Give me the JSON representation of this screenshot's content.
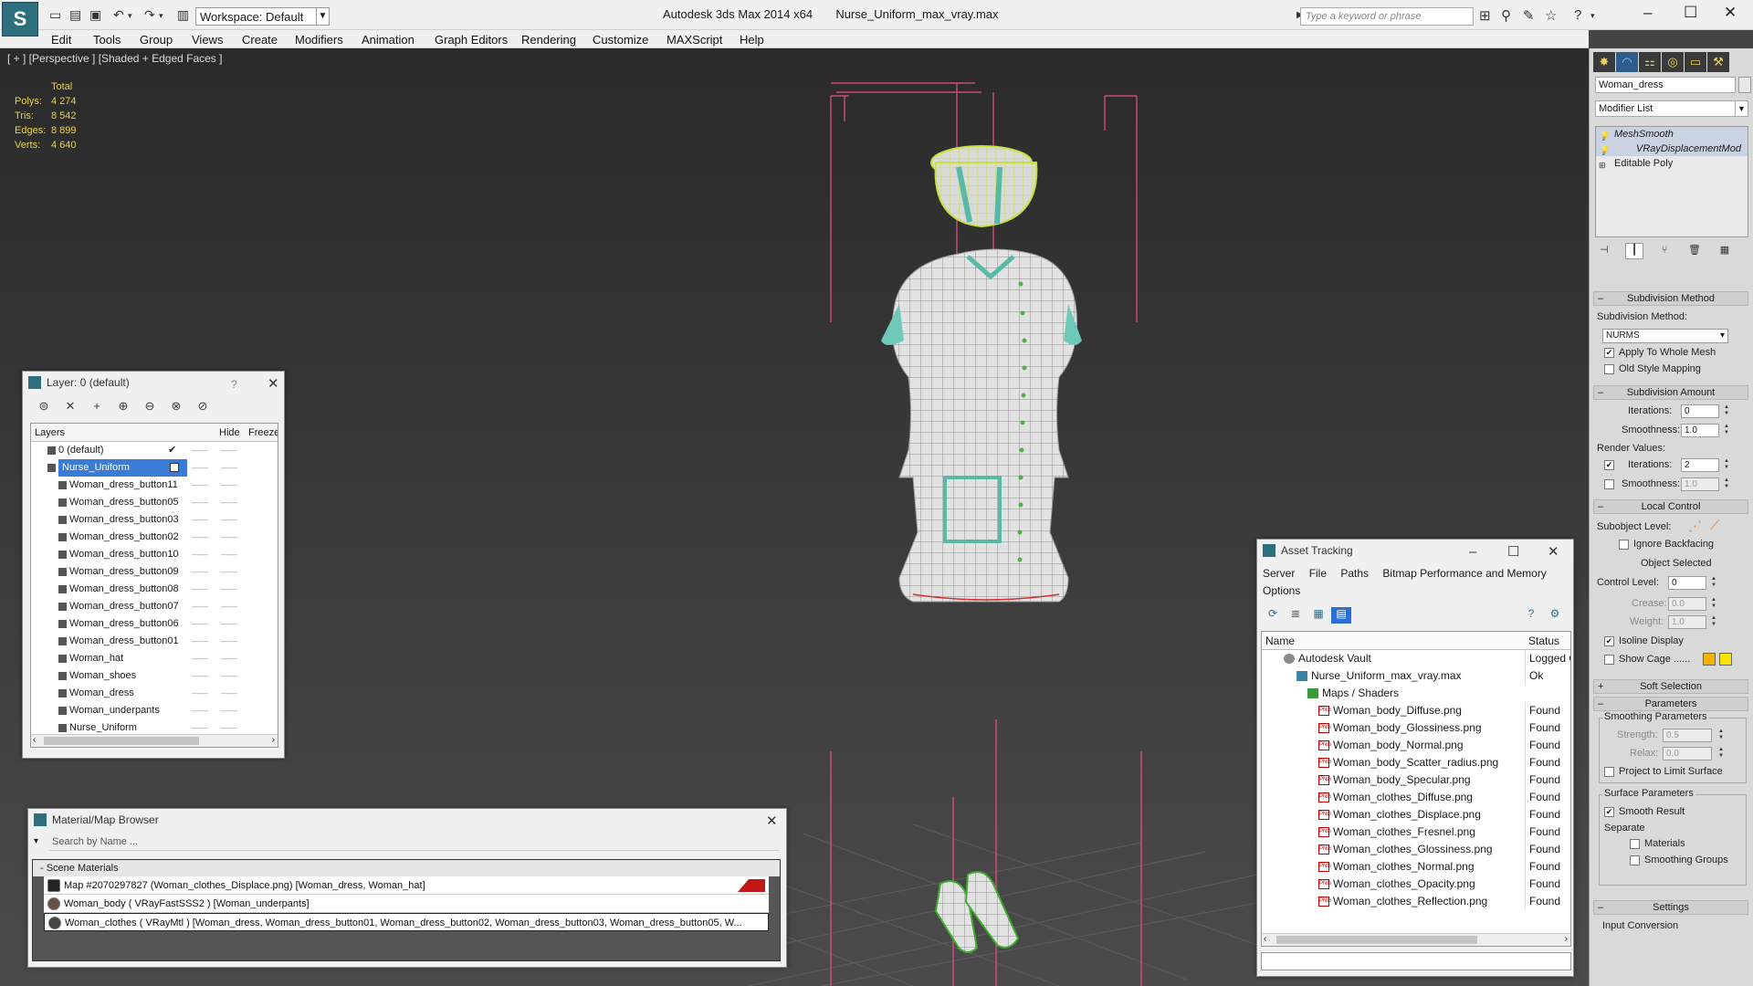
{
  "titlebar": {
    "app_logo": "S",
    "workspace": "Workspace: Default",
    "app_name": "Autodesk 3ds Max  2014 x64",
    "file_name": "Nurse_Uniform_max_vray.max",
    "search_placeholder": "Type a keyword or phrase"
  },
  "menu": [
    "Edit",
    "Tools",
    "Group",
    "Views",
    "Create",
    "Modifiers",
    "Animation",
    "Graph Editors",
    "Rendering",
    "Customize",
    "MAXScript",
    "Help"
  ],
  "viewport": {
    "label": "[ + ] [Perspective ] [Shaded + Edged Faces ]",
    "stats_header": "Total",
    "stats": [
      {
        "label": "Polys:",
        "value": "4 274"
      },
      {
        "label": "Tris:",
        "value": "8 542"
      },
      {
        "label": "Edges:",
        "value": "8 899"
      },
      {
        "label": "Verts:",
        "value": "4 640"
      }
    ]
  },
  "command_panel": {
    "object_name": "Woman_dress",
    "modifier_list": "Modifier List",
    "stack": [
      "MeshSmooth",
      "VRayDisplacementMod",
      "Editable Poly"
    ],
    "rollouts": {
      "subdivision_method": "Subdivision Method",
      "subdivision_method_label": "Subdivision Method:",
      "subdivision_method_value": "NURMS",
      "apply_whole_mesh": "Apply To Whole Mesh",
      "old_style_mapping": "Old Style Mapping",
      "subdivision_amount": "Subdivision Amount",
      "iterations_label": "Iterations:",
      "iterations_value": "0",
      "smoothness_label": "Smoothness:",
      "smoothness_value": "1.0",
      "render_values": "Render Values:",
      "render_iterations_value": "2",
      "render_smoothness_value": "1.0",
      "local_control": "Local Control",
      "subobject_level": "Subobject Level:",
      "ignore_backfacing": "Ignore Backfacing",
      "object_selected": "Object Selected",
      "control_level": "Control Level:",
      "control_level_value": "0",
      "crease": "Crease:",
      "crease_value": "0.0",
      "weight": "Weight:",
      "weight_value": "1.0",
      "isoline_display": "Isoline Display",
      "show_cage": "Show Cage ......",
      "soft_selection": "Soft Selection",
      "parameters": "Parameters",
      "smoothing_parameters": "Smoothing Parameters",
      "strength": "Strength:",
      "strength_value": "0.5",
      "relax": "Relax:",
      "relax_value": "0.0",
      "project_to_limit": "Project to Limit Surface",
      "surface_parameters": "Surface Parameters",
      "smooth_result": "Smooth Result",
      "separate": "Separate",
      "materials": "Materials",
      "smoothing_groups": "Smoothing Groups",
      "settings": "Settings",
      "input_conversion": "Input Conversion"
    },
    "cage_colors": [
      "#f2b400",
      "#f7e600"
    ]
  },
  "layer_dialog": {
    "title": "Layer: 0 (default)",
    "help": "?",
    "columns": {
      "layers": "Layers",
      "hide": "Hide",
      "freeze": "Freeze"
    },
    "rows": [
      {
        "name": "0 (default)",
        "level": 1,
        "check": "✔"
      },
      {
        "name": "Nurse_Uniform",
        "level": 1,
        "selected": true
      },
      {
        "name": "Woman_dress_button11",
        "level": 2
      },
      {
        "name": "Woman_dress_button05",
        "level": 2
      },
      {
        "name": "Woman_dress_button03",
        "level": 2
      },
      {
        "name": "Woman_dress_button02",
        "level": 2
      },
      {
        "name": "Woman_dress_button10",
        "level": 2
      },
      {
        "name": "Woman_dress_button09",
        "level": 2
      },
      {
        "name": "Woman_dress_button08",
        "level": 2
      },
      {
        "name": "Woman_dress_button07",
        "level": 2
      },
      {
        "name": "Woman_dress_button06",
        "level": 2
      },
      {
        "name": "Woman_dress_button01",
        "level": 2
      },
      {
        "name": "Woman_hat",
        "level": 2
      },
      {
        "name": "Woman_shoes",
        "level": 2
      },
      {
        "name": "Woman_dress",
        "level": 2
      },
      {
        "name": "Woman_underpants",
        "level": 2
      },
      {
        "name": "Nurse_Uniform",
        "level": 2
      }
    ]
  },
  "material_browser": {
    "title": "Material/Map Browser",
    "search_placeholder": "Search by Name ...",
    "group": "- Scene Materials",
    "items": [
      "Map #2070297827 (Woman_clothes_Displace.png)  [Woman_dress, Woman_hat]",
      "Woman_body  ( VRayFastSSS2 )  [Woman_underpants]",
      "Woman_clothes  ( VRayMtl )  [Woman_dress, Woman_dress_button01, Woman_dress_button02, Woman_dress_button03, Woman_dress_button05, W..."
    ]
  },
  "asset_tracking": {
    "title": "Asset Tracking",
    "menus": [
      "Server",
      "File",
      "Paths",
      "Bitmap Performance and Memory",
      "Options"
    ],
    "columns": {
      "name": "Name",
      "status": "Status"
    },
    "rows": [
      {
        "name": "Autodesk Vault",
        "status": "Logged Out",
        "level": 1,
        "icon": "vault"
      },
      {
        "name": "Nurse_Uniform_max_vray.max",
        "status": "Ok",
        "level": 2,
        "icon": "max"
      },
      {
        "name": "Maps / Shaders",
        "status": "",
        "level": 3,
        "icon": "maps"
      },
      {
        "name": "Woman_body_Diffuse.png",
        "status": "Found",
        "level": 4,
        "icon": "png"
      },
      {
        "name": "Woman_body_Glossiness.png",
        "status": "Found",
        "level": 4,
        "icon": "png"
      },
      {
        "name": "Woman_body_Normal.png",
        "status": "Found",
        "level": 4,
        "icon": "png"
      },
      {
        "name": "Woman_body_Scatter_radius.png",
        "status": "Found",
        "level": 4,
        "icon": "png"
      },
      {
        "name": "Woman_body_Specular.png",
        "status": "Found",
        "level": 4,
        "icon": "png"
      },
      {
        "name": "Woman_clothes_Diffuse.png",
        "status": "Found",
        "level": 4,
        "icon": "png"
      },
      {
        "name": "Woman_clothes_Displace.png",
        "status": "Found",
        "level": 4,
        "icon": "png"
      },
      {
        "name": "Woman_clothes_Fresnel.png",
        "status": "Found",
        "level": 4,
        "icon": "png"
      },
      {
        "name": "Woman_clothes_Glossiness.png",
        "status": "Found",
        "level": 4,
        "icon": "png"
      },
      {
        "name": "Woman_clothes_Normal.png",
        "status": "Found",
        "level": 4,
        "icon": "png"
      },
      {
        "name": "Woman_clothes_Opacity.png",
        "status": "Found",
        "level": 4,
        "icon": "png"
      },
      {
        "name": "Woman_clothes_Reflection.png",
        "status": "Found",
        "level": 4,
        "icon": "png"
      }
    ]
  }
}
